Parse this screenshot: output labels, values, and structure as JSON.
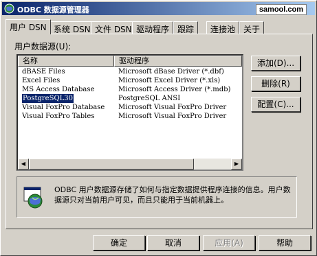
{
  "window": {
    "title": "ODBC 数据源管理器",
    "watermark": "samool.com"
  },
  "tabs": [
    {
      "label": "用户 DSN"
    },
    {
      "label": "系统 DSN"
    },
    {
      "label": "文件 DSN"
    },
    {
      "label": "驱动程序"
    },
    {
      "label": "跟踪"
    },
    {
      "label": "连接池"
    },
    {
      "label": "关于"
    }
  ],
  "list": {
    "label": "用户数据源(U):",
    "headers": [
      "名称",
      "驱动程序"
    ],
    "rows": [
      {
        "name": "dBASE Files",
        "driver": "Microsoft dBase Driver (*.dbf)"
      },
      {
        "name": "Excel Files",
        "driver": "Microsoft Excel Driver (*.xls)"
      },
      {
        "name": "MS Access Database",
        "driver": "Microsoft Access Driver (*.mdb)"
      },
      {
        "name": "PostgreSQL30",
        "driver": "PostgreSQL ANSI",
        "selected": true
      },
      {
        "name": "Visual FoxPro Database",
        "driver": "Microsoft Visual FoxPro Driver"
      },
      {
        "name": "Visual FoxPro Tables",
        "driver": "Microsoft Visual FoxPro Driver"
      }
    ]
  },
  "side_buttons": {
    "add": "添加(D)...",
    "remove": "删除(R)",
    "configure": "配置(C)..."
  },
  "info": {
    "text": "ODBC 用户数据源存储了如何与指定数据提供程序连接的信息。用户数据源只对当前用户可见，而且只能用于当前机器上。"
  },
  "footer": {
    "ok": "确定",
    "cancel": "取消",
    "apply": "应用(A)",
    "help": "帮助"
  }
}
